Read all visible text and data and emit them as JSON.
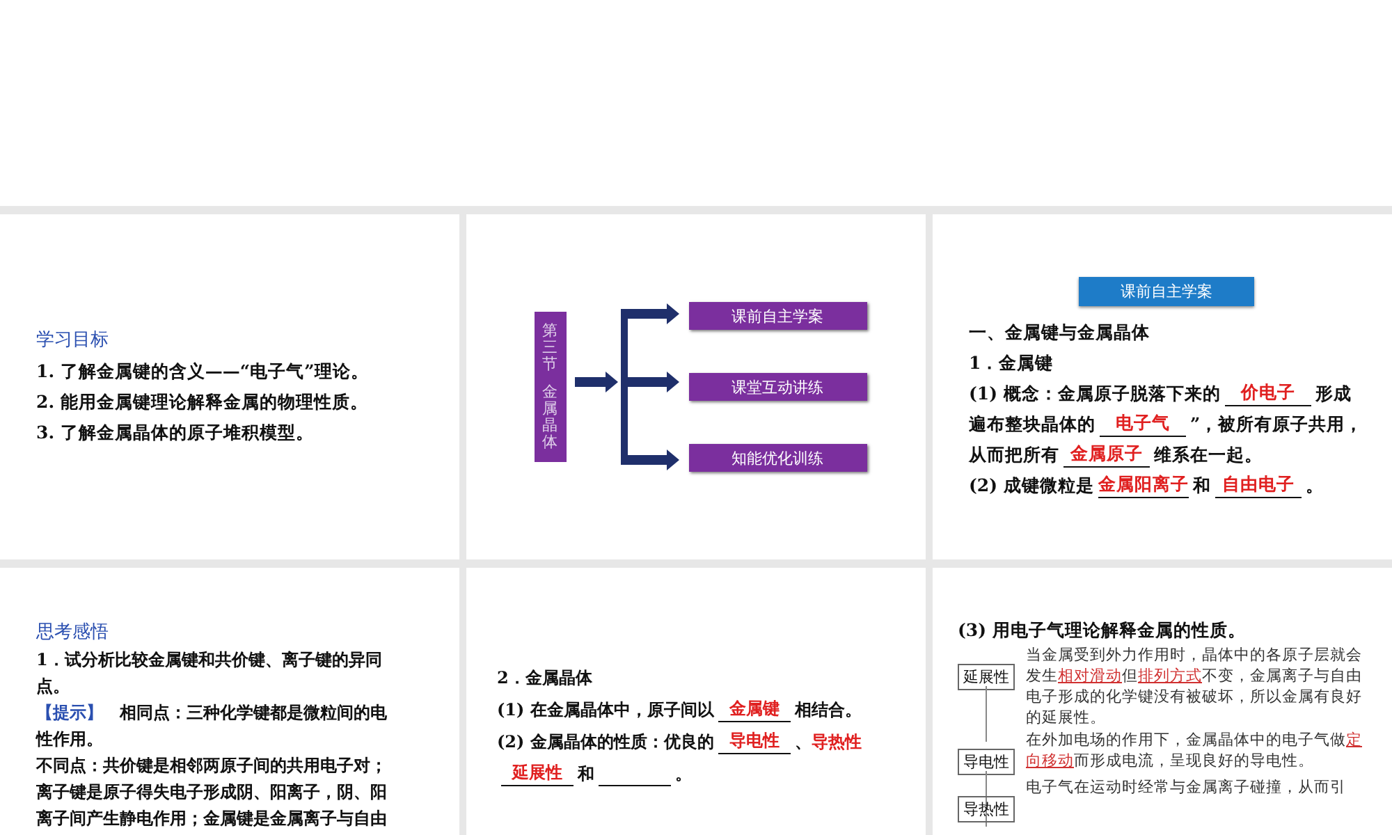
{
  "slides": [
    {
      "kind": "text",
      "blocks": [
        {
          "kind": "heading",
          "text": "学习目标"
        },
        {
          "kind": "line",
          "segments": [
            {
              "kind": "text",
              "text": "1. 了解金属键的含义——“电子气”理论。"
            }
          ]
        },
        {
          "kind": "line",
          "segments": [
            {
              "kind": "text",
              "text": "2. 能用金属键理论解释金属的物理性质。"
            }
          ]
        },
        {
          "kind": "line",
          "segments": [
            {
              "kind": "text",
              "text": "3. 了解金属晶体的原子堆积模型。"
            }
          ]
        }
      ]
    },
    {
      "kind": "outline",
      "labels": [
        "第三节",
        "金属晶体"
      ],
      "buttons": [
        "课前自主学案",
        "课堂互动讲练",
        "知能优化训练"
      ]
    },
    {
      "kind": "text",
      "blocks": [
        {
          "kind": "banner",
          "text": "课前自主学案"
        },
        {
          "kind": "line",
          "segments": [
            {
              "kind": "text",
              "text": "一、金属键与金属晶体"
            }
          ]
        },
        {
          "kind": "line",
          "segments": [
            {
              "kind": "text",
              "text": "1．金属键"
            }
          ]
        },
        {
          "kind": "line",
          "segments": [
            {
              "kind": "text",
              "text": "(1) 概念：金属原子脱落下来的"
            },
            {
              "kind": "blank",
              "answer": "价电子"
            },
            {
              "kind": "text",
              "text": "形成"
            }
          ]
        },
        {
          "kind": "line",
          "segments": [
            {
              "kind": "text",
              "text": "遍布整块晶体的"
            },
            {
              "kind": "blank",
              "answer": "电子气"
            },
            {
              "kind": "text",
              "text": "”，被所有原子共用，"
            }
          ]
        },
        {
          "kind": "line",
          "segments": [
            {
              "kind": "text",
              "text": "从而把所有"
            },
            {
              "kind": "blank",
              "answer": "金属原子"
            },
            {
              "kind": "text",
              "text": "维系在一起。"
            }
          ]
        },
        {
          "kind": "line",
          "segments": [
            {
              "kind": "text",
              "text": "(2) 成键微粒是"
            },
            {
              "kind": "blank",
              "answer": "金属阳离子"
            },
            {
              "kind": "text",
              "text": "和"
            },
            {
              "kind": "blank",
              "answer": "自由电子"
            },
            {
              "kind": "text",
              "text": "。"
            }
          ]
        }
      ]
    },
    {
      "kind": "text",
      "blocks": [
        {
          "kind": "heading",
          "text": "思考感悟"
        },
        {
          "kind": "line",
          "segments": [
            {
              "kind": "text",
              "text": "1．试分析比较金属键和共价键、离子键的异同"
            }
          ]
        },
        {
          "kind": "line",
          "segments": [
            {
              "kind": "text",
              "text": "点。"
            }
          ]
        },
        {
          "kind": "line",
          "segments": [
            {
              "kind": "label",
              "text": "【提示】"
            },
            {
              "kind": "text",
              "text": "相同点：三种化学键都是微粒间的电"
            }
          ]
        },
        {
          "kind": "line",
          "segments": [
            {
              "kind": "text",
              "text": "性作用。"
            }
          ]
        },
        {
          "kind": "line",
          "segments": [
            {
              "kind": "text",
              "text": "不同点：共价键是相邻两原子间的共用电子对；"
            }
          ]
        },
        {
          "kind": "line",
          "segments": [
            {
              "kind": "text",
              "text": "离子键是原子得失电子形成阴、阳离子，阴、阳"
            }
          ]
        },
        {
          "kind": "line",
          "segments": [
            {
              "kind": "text",
              "text": "离子间产生静电作用；金属键是金属离子与自由"
            }
          ]
        }
      ]
    },
    {
      "kind": "text",
      "blocks": [
        {
          "kind": "line",
          "segments": [
            {
              "kind": "text",
              "text": "2．金属晶体"
            }
          ]
        },
        {
          "kind": "line",
          "segments": [
            {
              "kind": "text",
              "text": "(1) 在金属晶体中，原子间以"
            },
            {
              "kind": "blank",
              "answer": "金属键"
            },
            {
              "kind": "text",
              "text": "相结合。"
            }
          ]
        },
        {
          "kind": "line",
          "segments": [
            {
              "kind": "text",
              "text": "(2) 金属晶体的性质：优良的"
            },
            {
              "kind": "blank",
              "answer": "导电性"
            },
            {
              "kind": "text",
              "text": "、"
            },
            {
              "kind": "answer",
              "text": "导热性"
            }
          ]
        },
        {
          "kind": "line",
          "segments": [
            {
              "kind": "blank",
              "answer": "延展性"
            },
            {
              "kind": "text",
              "text": "和"
            },
            {
              "kind": "blank"
            },
            {
              "kind": "text",
              "text": "。"
            }
          ]
        }
      ]
    },
    {
      "kind": "tree",
      "heading": "(3) 用电子气理论解释金属的性质。",
      "items": [
        {
          "label": "延展性",
          "segments": [
            {
              "kind": "text",
              "text": "当金属受到外力作用时，晶体中的各原子层就会发生"
            },
            {
              "kind": "mark",
              "text": "相对滑动"
            },
            {
              "kind": "text",
              "text": "但"
            },
            {
              "kind": "mark",
              "text": "排列方式"
            },
            {
              "kind": "text",
              "text": "不变，金属离子与自由电子形成的化学键没有被破坏，所以金属有良好的延展性。"
            }
          ]
        },
        {
          "label": "导电性",
          "segments": [
            {
              "kind": "text",
              "text": "在外加电场的作用下，金属晶体中的电子气做"
            },
            {
              "kind": "mark",
              "text": "定向移动"
            },
            {
              "kind": "text",
              "text": "而形成电流，呈现良好的导电性。"
            }
          ]
        },
        {
          "label": "导热性",
          "segments": [
            {
              "kind": "text",
              "text": "电子气在运动时经常与金属离子碰撞，从而引"
            }
          ]
        }
      ]
    }
  ]
}
